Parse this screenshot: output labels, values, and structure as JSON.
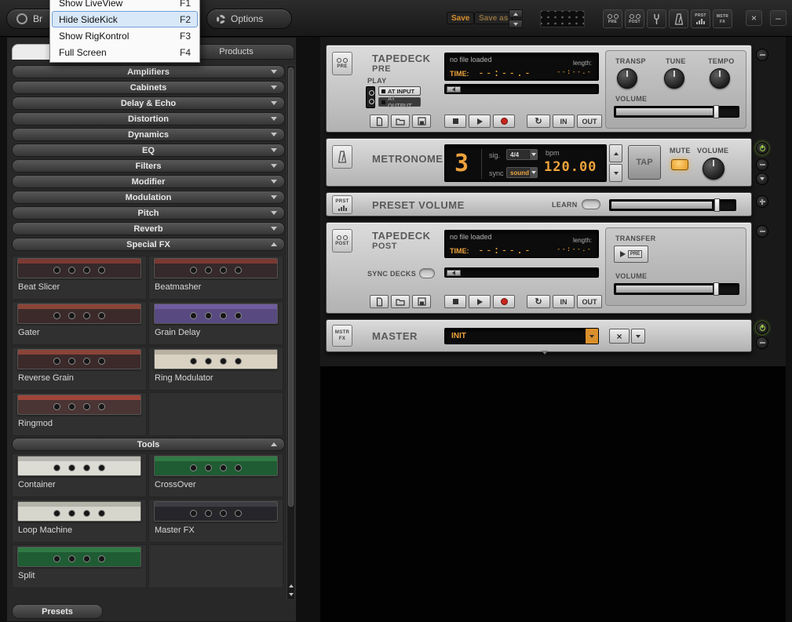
{
  "colors": {
    "amber": "#eda33c",
    "record_red": "#c8251d",
    "power_green": "#9fd045",
    "menu_highlight": "#d9e8f8"
  },
  "topbar": {
    "browser_label": "Br",
    "options_label": "Options",
    "save_label": "Save",
    "save_as_label": "Save as"
  },
  "menu": {
    "items": [
      {
        "label": "Show LiveView",
        "shortcut": "F1"
      },
      {
        "label": "Hide SideKick",
        "shortcut": "F2"
      },
      {
        "label": "Show RigKontrol",
        "shortcut": "F3"
      },
      {
        "label": "Full Screen",
        "shortcut": "F4"
      }
    ]
  },
  "quickbar": {
    "pre": "PRE",
    "post": "POST",
    "prst": "PRST",
    "mstr": "MSTR",
    "fx": "FX"
  },
  "sidebar": {
    "products_tab": "Products",
    "categories": [
      "Amplifiers",
      "Cabinets",
      "Delay & Echo",
      "Distortion",
      "Dynamics",
      "EQ",
      "Filters",
      "Modifier",
      "Modulation",
      "Pitch",
      "Reverb",
      "Special FX"
    ],
    "special_fx_items": [
      {
        "name": "Beat Slicer",
        "body": "#35292b",
        "strip": "#7a3a32"
      },
      {
        "name": "Beatmasher",
        "body": "#35292b",
        "strip": "#7a3a32"
      },
      {
        "name": "Gater",
        "body": "#3c2a2a",
        "strip": "#8a4438"
      },
      {
        "name": "Grain Delay",
        "body": "#584a80",
        "strip": "#6e5c9e"
      },
      {
        "name": "Reverse Grain",
        "body": "#3c2a2a",
        "strip": "#8a4438"
      },
      {
        "name": "Ring Modulator",
        "body": "#d9d2c2",
        "strip": "#b8b0a0"
      },
      {
        "name": "Ringmod",
        "body": "#4a3434",
        "strip": "#a04438"
      }
    ],
    "tools_header": "Tools",
    "tools_items": [
      {
        "name": "Container",
        "body": "#dcdcd4",
        "strip": "#b8b8b0"
      },
      {
        "name": "CrossOver",
        "body": "#1f5c33",
        "strip": "#2f7a45"
      },
      {
        "name": "Loop Machine",
        "body": "#d6d6cc",
        "strip": "#b4b4aa"
      },
      {
        "name": "Master FX",
        "body": "#26262a",
        "strip": "#3c3c42"
      },
      {
        "name": "Split",
        "body": "#1f5c33",
        "strip": "#2f7a45"
      }
    ],
    "presets_button": "Presets"
  },
  "rack": {
    "tapedeck_pre": {
      "icon_label": "PRE",
      "title": "TAPEDECK",
      "subtitle": "PRE",
      "play_label": "PLAY",
      "at_input": "AT INPUT",
      "at_output": "AT OUTPUT",
      "file_status": "no file loaded",
      "time_label": "TIME:",
      "time_value": "--:--.-",
      "length_label": "length:",
      "length_value": "--:--.-",
      "knob_labels": [
        "TRANSP",
        "TUNE",
        "TEMPO"
      ],
      "volume_label": "VOLUME",
      "in_label": "IN",
      "out_label": "OUT"
    },
    "metronome": {
      "title": "METRONOME",
      "beat_count": "3",
      "sig_label": "sig.",
      "sig_value": "4/4",
      "sync_label": "sync",
      "sync_value": "sound",
      "bpm_label": "bpm",
      "bpm_value": "120.00",
      "tap_label": "TAP",
      "mute_label": "MUTE",
      "volume_label": "VOLUME"
    },
    "preset_volume": {
      "icon_label": "PRST",
      "title": "PRESET VOLUME",
      "learn_label": "LEARN"
    },
    "tapedeck_post": {
      "icon_label": "POST",
      "title": "TAPEDECK",
      "subtitle": "POST",
      "file_status": "no file loaded",
      "time_label": "TIME:",
      "time_value": "--:--.-",
      "length_label": "length:",
      "length_value": "--:--.-",
      "sync_decks_label": "SYNC DECKS",
      "transfer_label": "TRANSFER",
      "transfer_target": "PRE",
      "volume_label": "VOLUME",
      "in_label": "IN",
      "out_label": "OUT"
    },
    "master": {
      "icon_line1": "MSTR",
      "icon_line2": "FX",
      "title": "MASTER",
      "preset_value": "INIT"
    }
  }
}
